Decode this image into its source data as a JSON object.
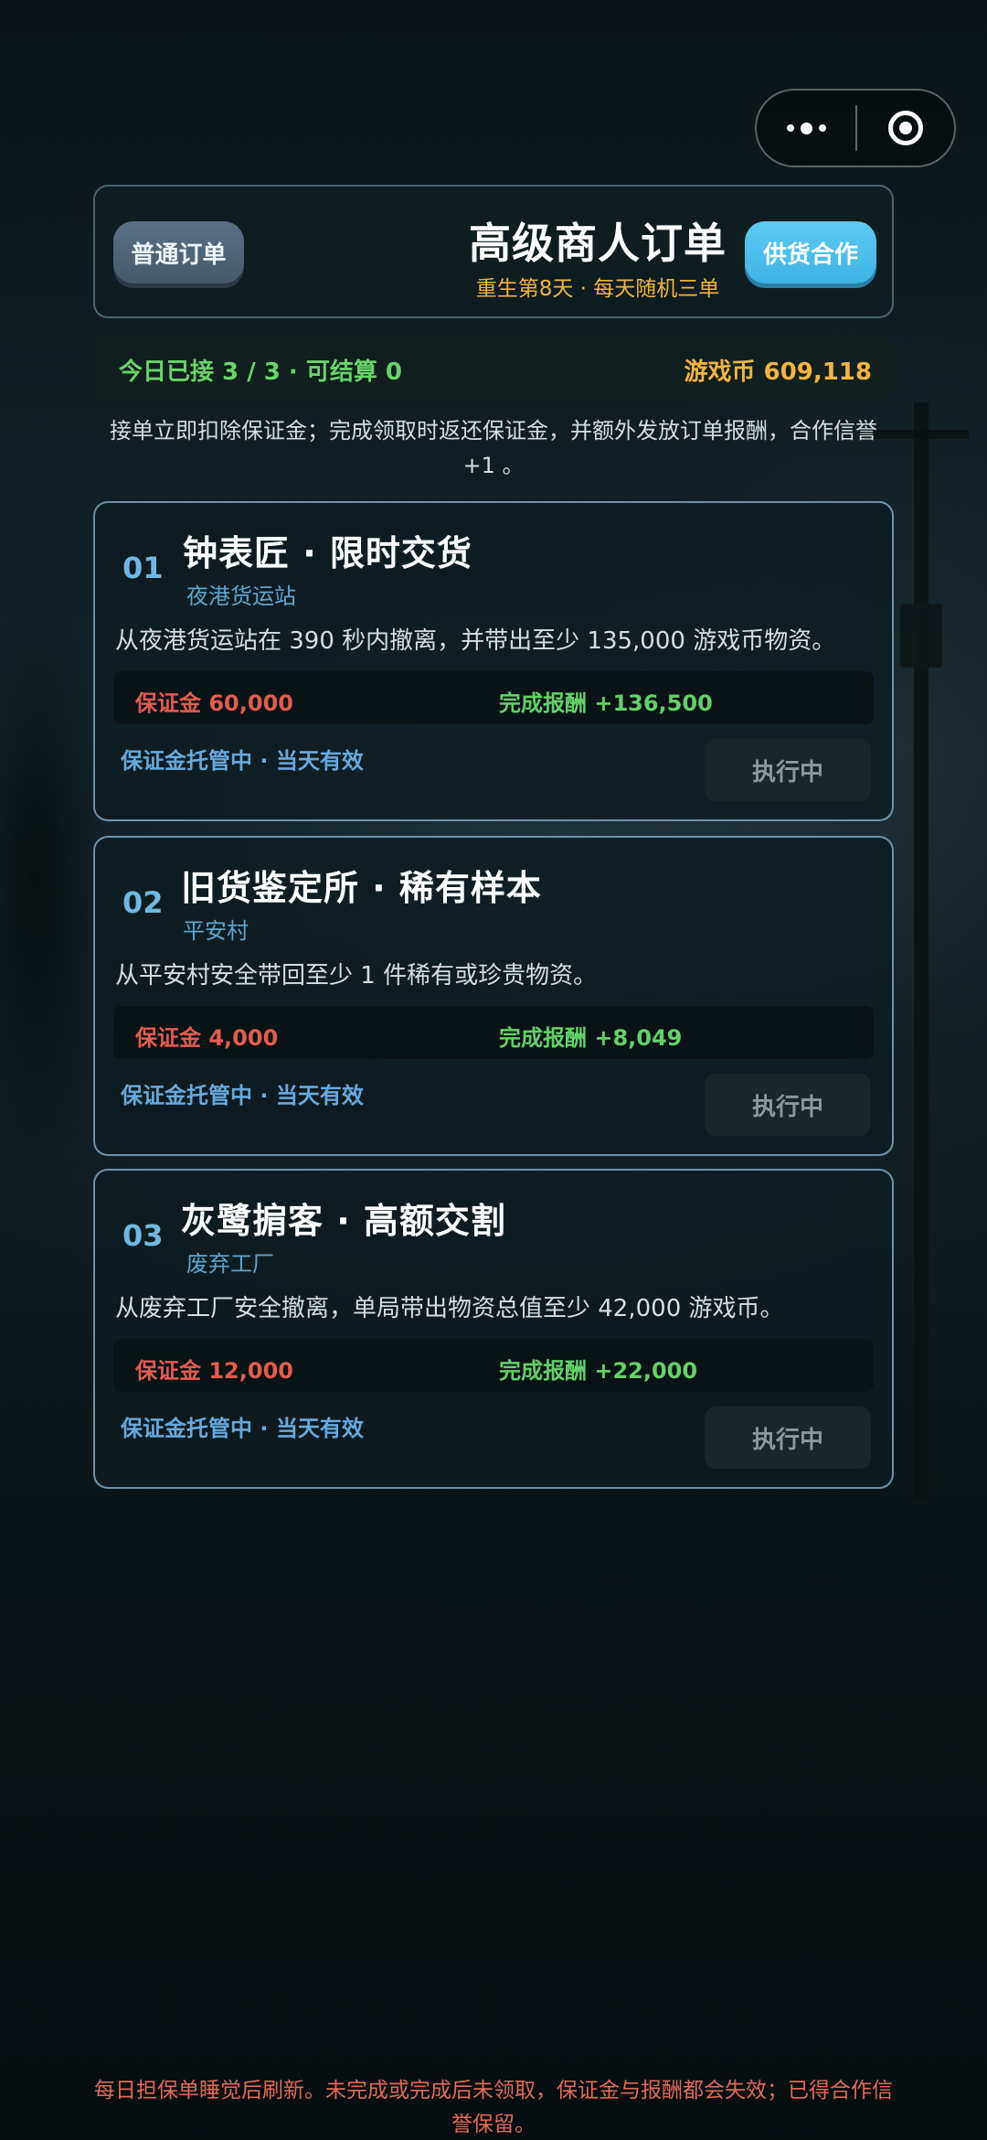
{
  "capsule": {
    "more_icon": "more-dots-icon",
    "record_icon": "record-target-icon"
  },
  "header": {
    "left_button": "普通订单",
    "title": "高级商人订单",
    "subtitle": "重生第8天 · 每天随机三单",
    "right_button": "供货合作"
  },
  "stats": {
    "left": "今日已接 3 / 3 · 可结算 0",
    "right": "游戏币 609,118"
  },
  "info": "接单立即扣除保证金；完成领取时返还保证金，并额外发放订单报酬，合作信誉 +1 。",
  "orders": [
    {
      "num": "01",
      "title": "钟表匠 · 限时交货",
      "location": "夜港货运站",
      "desc": "从夜港货运站在 390 秒内撤离，并带出至少 135,000 游戏币物资。",
      "deposit": "保证金 60,000",
      "reward": "完成报酬 +136,500",
      "escrow": "保证金托管中 · 当天有效",
      "action": "执行中"
    },
    {
      "num": "02",
      "title": "旧货鉴定所 · 稀有样本",
      "location": "平安村",
      "desc": "从平安村安全带回至少 1 件稀有或珍贵物资。",
      "deposit": "保证金 4,000",
      "reward": "完成报酬 +8,049",
      "escrow": "保证金托管中 · 当天有效",
      "action": "执行中"
    },
    {
      "num": "03",
      "title": "灰鹭掮客 · 高额交割",
      "location": "废弃工厂",
      "desc": "从废弃工厂安全撤离，单局带出物资总值至少 42,000 游戏币。",
      "deposit": "保证金 12,000",
      "reward": "完成报酬 +22,000",
      "escrow": "保证金托管中 · 当天有效",
      "action": "执行中"
    }
  ],
  "footer": "每日担保单睡觉后刷新。未完成或完成后未领取，保证金与报酬都会失效；已得合作信誉保留。"
}
